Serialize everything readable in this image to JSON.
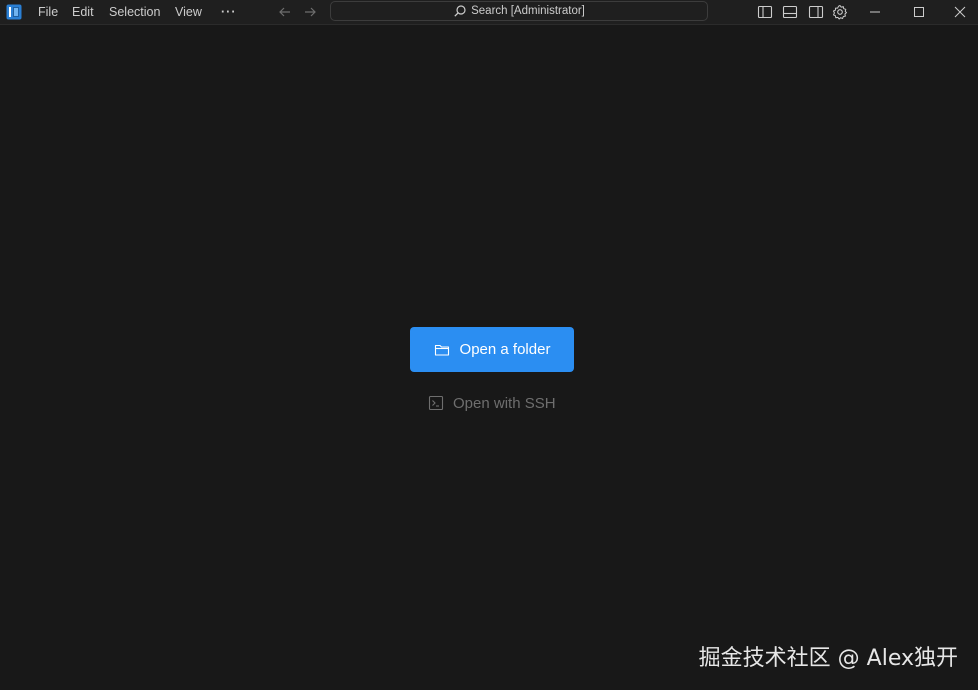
{
  "titlebar": {
    "menu": {
      "file": "File",
      "edit": "Edit",
      "selection": "Selection",
      "view": "View",
      "more": "···"
    },
    "search": {
      "label": "Search [Administrator]"
    },
    "icons": {
      "app": "app-logo-icon",
      "back": "arrow-left-icon",
      "forward": "arrow-right-icon",
      "primary_sidebar": "toggle-primary-sidebar-icon",
      "panel": "toggle-panel-icon",
      "secondary_sidebar": "toggle-secondary-sidebar-icon",
      "settings": "gear-icon",
      "minimize": "minimize-icon",
      "maximize": "maximize-icon",
      "close": "close-icon"
    }
  },
  "welcome": {
    "open_folder_label": "Open a folder",
    "open_ssh_label": "Open with SSH"
  },
  "watermark": {
    "text": "掘金技术社区 @ Alex独开"
  },
  "colors": {
    "background": "#181818",
    "titlebar": "#1f1f1f",
    "accent": "#2b8ef2",
    "muted_text": "#6e6e6e",
    "text": "#cccccc"
  }
}
